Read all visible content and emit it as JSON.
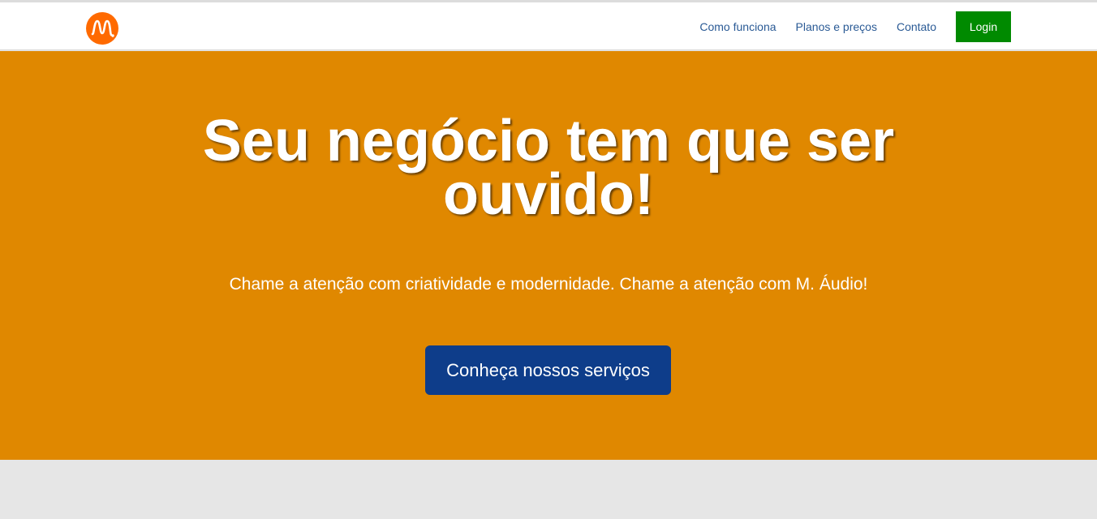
{
  "nav": {
    "links": [
      {
        "label": "Como funciona"
      },
      {
        "label": "Planos e preços"
      },
      {
        "label": "Contato"
      }
    ],
    "login_label": "Login"
  },
  "hero": {
    "title": "Seu negócio tem que ser ouvido!",
    "subtitle": "Chame a atenção com criatividade e modernidade. Chame a atenção com M. Áudio!",
    "cta_label": "Conheça nossos serviços"
  },
  "colors": {
    "brand_orange": "#e08800",
    "logo_orange": "#ff6a00",
    "nav_link": "#2a5a95",
    "login_green": "#008a00",
    "cta_blue": "#0e3d8a",
    "footer_gray": "#e6e6e6"
  },
  "icons": {
    "logo": "m-audio-wave-logo-icon"
  }
}
